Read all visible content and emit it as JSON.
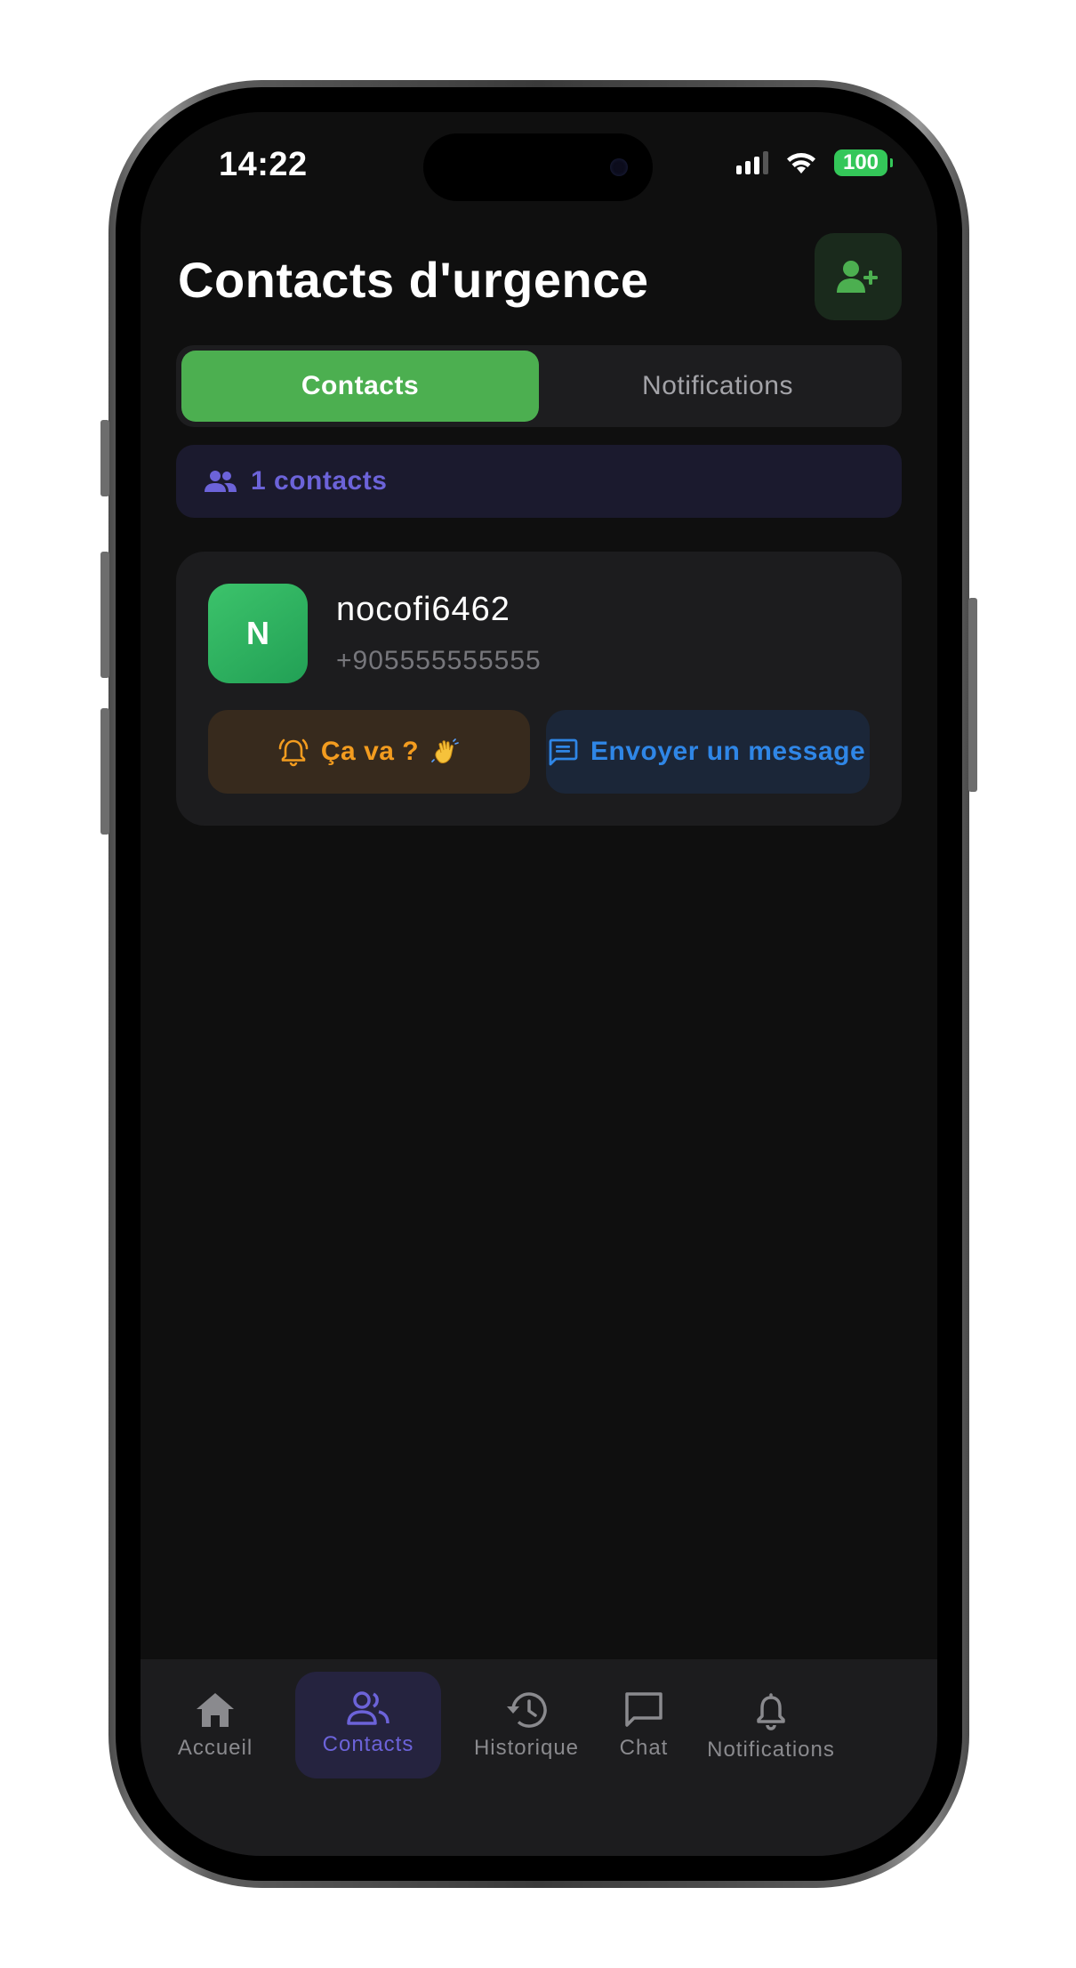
{
  "status_bar": {
    "time": "14:22",
    "battery": "100"
  },
  "header": {
    "title": "Contacts d'urgence",
    "add_icon": "person-add-icon"
  },
  "tabs": [
    {
      "label": "Contacts",
      "active": true
    },
    {
      "label": "Notifications",
      "active": false
    }
  ],
  "count_badge": {
    "label": "1 contacts",
    "icon": "people-icon"
  },
  "contacts": [
    {
      "initial": "N",
      "name": "nocofi6462",
      "phone": "+905555555555",
      "ping_label": "Ça va ?",
      "ping_icon": "bell-ring-icon",
      "ping_emoji": "waving-hand",
      "message_label": "Envoyer un message",
      "message_icon": "message-icon"
    }
  ],
  "bottom_nav": [
    {
      "label": "Accueil",
      "icon": "home-icon",
      "active": false
    },
    {
      "label": "Contacts",
      "icon": "people-icon",
      "active": true
    },
    {
      "label": "Historique",
      "icon": "history-icon",
      "active": false
    },
    {
      "label": "Chat",
      "icon": "chat-icon",
      "active": false
    },
    {
      "label": "Notifications",
      "icon": "bell-icon",
      "active": false
    }
  ],
  "colors": {
    "accent_green": "#4caf50",
    "accent_purple": "#6c63d9",
    "ping_orange": "#f39c1f",
    "message_blue": "#2f86e6",
    "background": "#0f0f0f",
    "card": "#1c1c1e"
  }
}
